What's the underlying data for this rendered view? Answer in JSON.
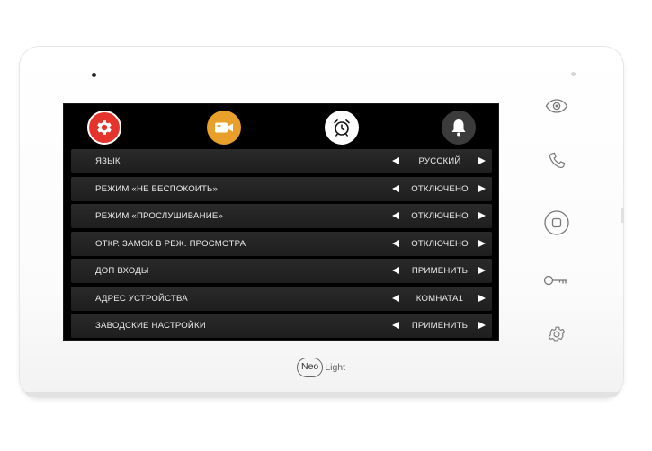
{
  "brand": {
    "name_left": "Neo",
    "name_right": "Light"
  },
  "tabs": [
    {
      "name": "settings-tab",
      "icon": "gear-icon",
      "color": "#e5342b",
      "active": true
    },
    {
      "name": "video-tab",
      "icon": "video-camera-icon",
      "color": "#e9a02b",
      "active": false
    },
    {
      "name": "alarm-tab",
      "icon": "alarm-clock-icon",
      "color": "#ffffff",
      "active": false
    },
    {
      "name": "bell-tab",
      "icon": "bell-icon",
      "color": "#3b3b3b",
      "active": false
    }
  ],
  "settings": {
    "rows": [
      {
        "label": "ЯЗЫК",
        "value": "РУССКИЙ"
      },
      {
        "label": "РЕЖИМ «НЕ БЕСПОКОИТЬ»",
        "value": "ОТКЛЮЧЕНО"
      },
      {
        "label": "РЕЖИМ «ПРОСЛУШИВАНИЕ»",
        "value": "ОТКЛЮЧЕНО"
      },
      {
        "label": "ОТКР. ЗАМОК В РЕЖ. ПРОСМОТРА",
        "value": "ОТКЛЮЧЕНО"
      },
      {
        "label": "ДОП ВХОДЫ",
        "value": "ПРИМЕНИТЬ"
      },
      {
        "label": "АДРЕС УСТРОЙСТВА",
        "value": "КОМНАТА1"
      },
      {
        "label": "ЗАВОДСКИЕ НАСТРОЙКИ",
        "value": "ПРИМЕНИТЬ"
      }
    ]
  },
  "side_buttons": [
    {
      "name": "monitor-button",
      "icon": "eye-icon"
    },
    {
      "name": "call-button",
      "icon": "phone-icon"
    },
    {
      "name": "menu-button",
      "icon": "square-button-icon"
    },
    {
      "name": "unlock-button",
      "icon": "key-icon"
    },
    {
      "name": "settings-button",
      "icon": "gear-icon"
    }
  ]
}
